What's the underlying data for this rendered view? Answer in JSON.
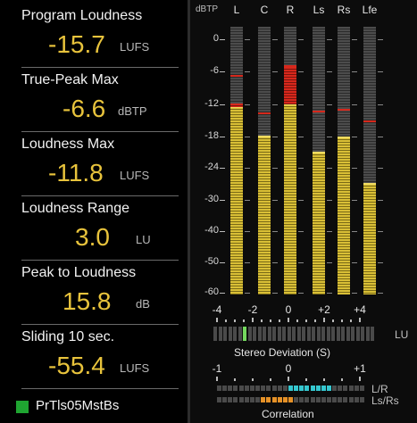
{
  "metrics": [
    {
      "label": "Program Loudness",
      "value": "-15.7",
      "unit": "LUFS"
    },
    {
      "label": "True-Peak Max",
      "value": "-6.6",
      "unit": "dBTP"
    },
    {
      "label": "Loudness Max",
      "value": "-11.8",
      "unit": "LUFS"
    },
    {
      "label": "Loudness Range",
      "value": "3.0",
      "unit": "LU"
    },
    {
      "label": "Peak to Loudness",
      "value": "15.8",
      "unit": "dB"
    },
    {
      "label": "Sliding 10 sec.",
      "value": "-55.4",
      "unit": "LUFS"
    }
  ],
  "preset": {
    "name": "PrTls05MstBs",
    "color": "#1fa531"
  },
  "meters": {
    "scale_title": "dBTP",
    "scale": [
      "0",
      "-6",
      "-12",
      "-18",
      "-24",
      "-30",
      "-40",
      "-50",
      "-60"
    ],
    "channels": [
      {
        "name": "L",
        "level_db": -12.5,
        "red_top_db": -11.8,
        "peak_db": -6.6
      },
      {
        "name": "C",
        "level_db": -18.0,
        "peak_db": -13.5
      },
      {
        "name": "R",
        "level_db": -12.0,
        "red_top_db": -5.2,
        "peak_db": -4.8
      },
      {
        "name": "Ls",
        "level_db": -21.0,
        "peak_db": -13.2
      },
      {
        "name": "Rs",
        "level_db": -18.2,
        "peak_db": -12.8
      },
      {
        "name": "Lfe",
        "level_db": -27.0,
        "peak_db": -15.0
      }
    ]
  },
  "stereo_deviation": {
    "ticks": [
      "-4",
      "-2",
      "0",
      "+2",
      "+4"
    ],
    "unit": "LU",
    "title": "Stereo Deviation (S)",
    "value": -2.6,
    "indicator_color": "#74d85e"
  },
  "correlation": {
    "ticks": [
      "-1",
      "0",
      "+1"
    ],
    "rows": [
      "L/R",
      "Ls/Rs"
    ],
    "title": "Correlation",
    "lr_range": [
      0.0,
      0.6
    ],
    "lsrs_range": [
      -0.4,
      0.0
    ],
    "lr_color": "#35c7cf",
    "lsrs_color": "#e59127"
  }
}
